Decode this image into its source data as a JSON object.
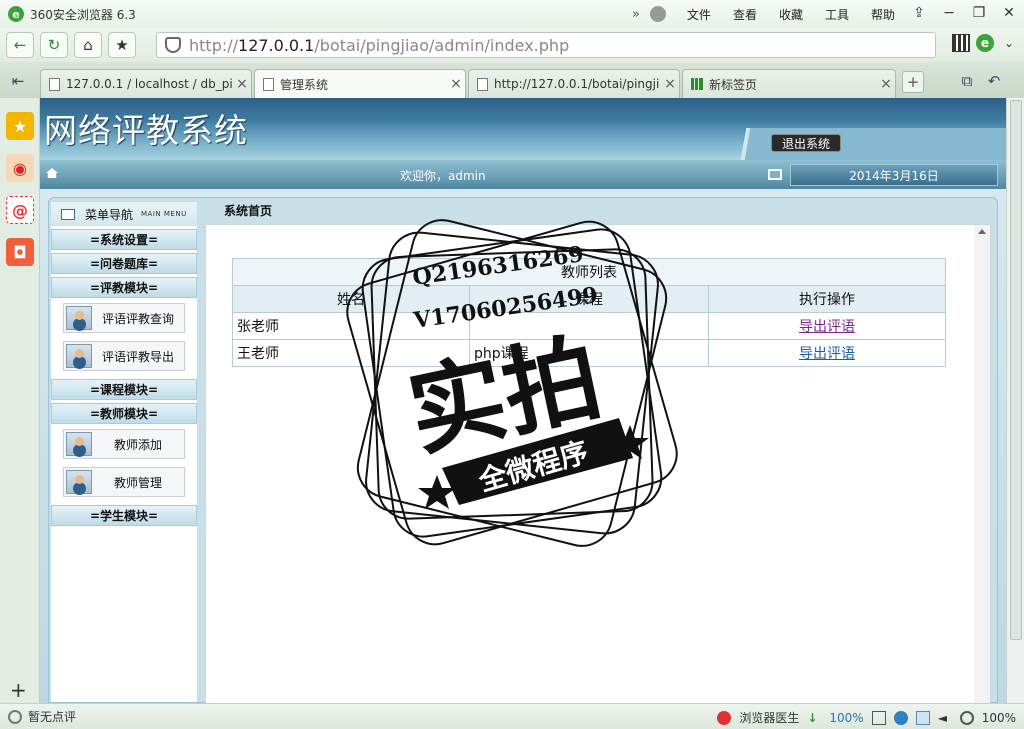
{
  "browser": {
    "title": "360安全浏览器 6.3",
    "menus": [
      "文件",
      "查看",
      "收藏",
      "工具",
      "帮助"
    ],
    "url_host": "127.0.0.1",
    "url_prefix": "http://",
    "url_path": "/botai/pingjiao/admin/index.php",
    "tabs": [
      {
        "label": "127.0.0.1 / localhost / db_pi",
        "active": false
      },
      {
        "label": "管理系统",
        "active": true
      },
      {
        "label": "http://127.0.0.1/botai/pingji",
        "active": false
      },
      {
        "label": "新标签页",
        "active": false
      }
    ],
    "status": {
      "rating": "暂无点评",
      "doctor": "浏览器医生",
      "speed": "100%",
      "zoom": "100%"
    }
  },
  "app": {
    "system_title": "网络评教系统",
    "logout": "退出系统",
    "welcome": "欢迎你，admin",
    "date": "2014年3月16日",
    "content_title": "系统首页"
  },
  "nav": {
    "title": "菜单导航",
    "subtitle": "MAIN MENU",
    "groups": [
      {
        "label": "=系统设置=",
        "items": []
      },
      {
        "label": "=问卷题库=",
        "items": []
      },
      {
        "label": "=评教模块=",
        "items": [
          "评语评教查询",
          "评语评教导出"
        ]
      },
      {
        "label": "=课程模块=",
        "items": []
      },
      {
        "label": "=教师模块=",
        "items": [
          "教师添加",
          "教师管理"
        ]
      },
      {
        "label": "=学生模块=",
        "items": []
      }
    ]
  },
  "table": {
    "caption": "教师列表",
    "headers": [
      "姓名",
      "课程",
      "执行操作"
    ],
    "rows": [
      {
        "name": "张老师",
        "course": "",
        "action": "导出评语"
      },
      {
        "name": "王老师",
        "course": "php课程",
        "action": "导出评语"
      }
    ]
  },
  "watermark": {
    "line1": "Q2196316269",
    "line2": "V17060256499",
    "main": "实拍",
    "banner": "全微程序"
  },
  "colors": {
    "header_dark": "#2d5f86",
    "link": "#1d5fa6",
    "link_visited": "#7b2b8d"
  }
}
